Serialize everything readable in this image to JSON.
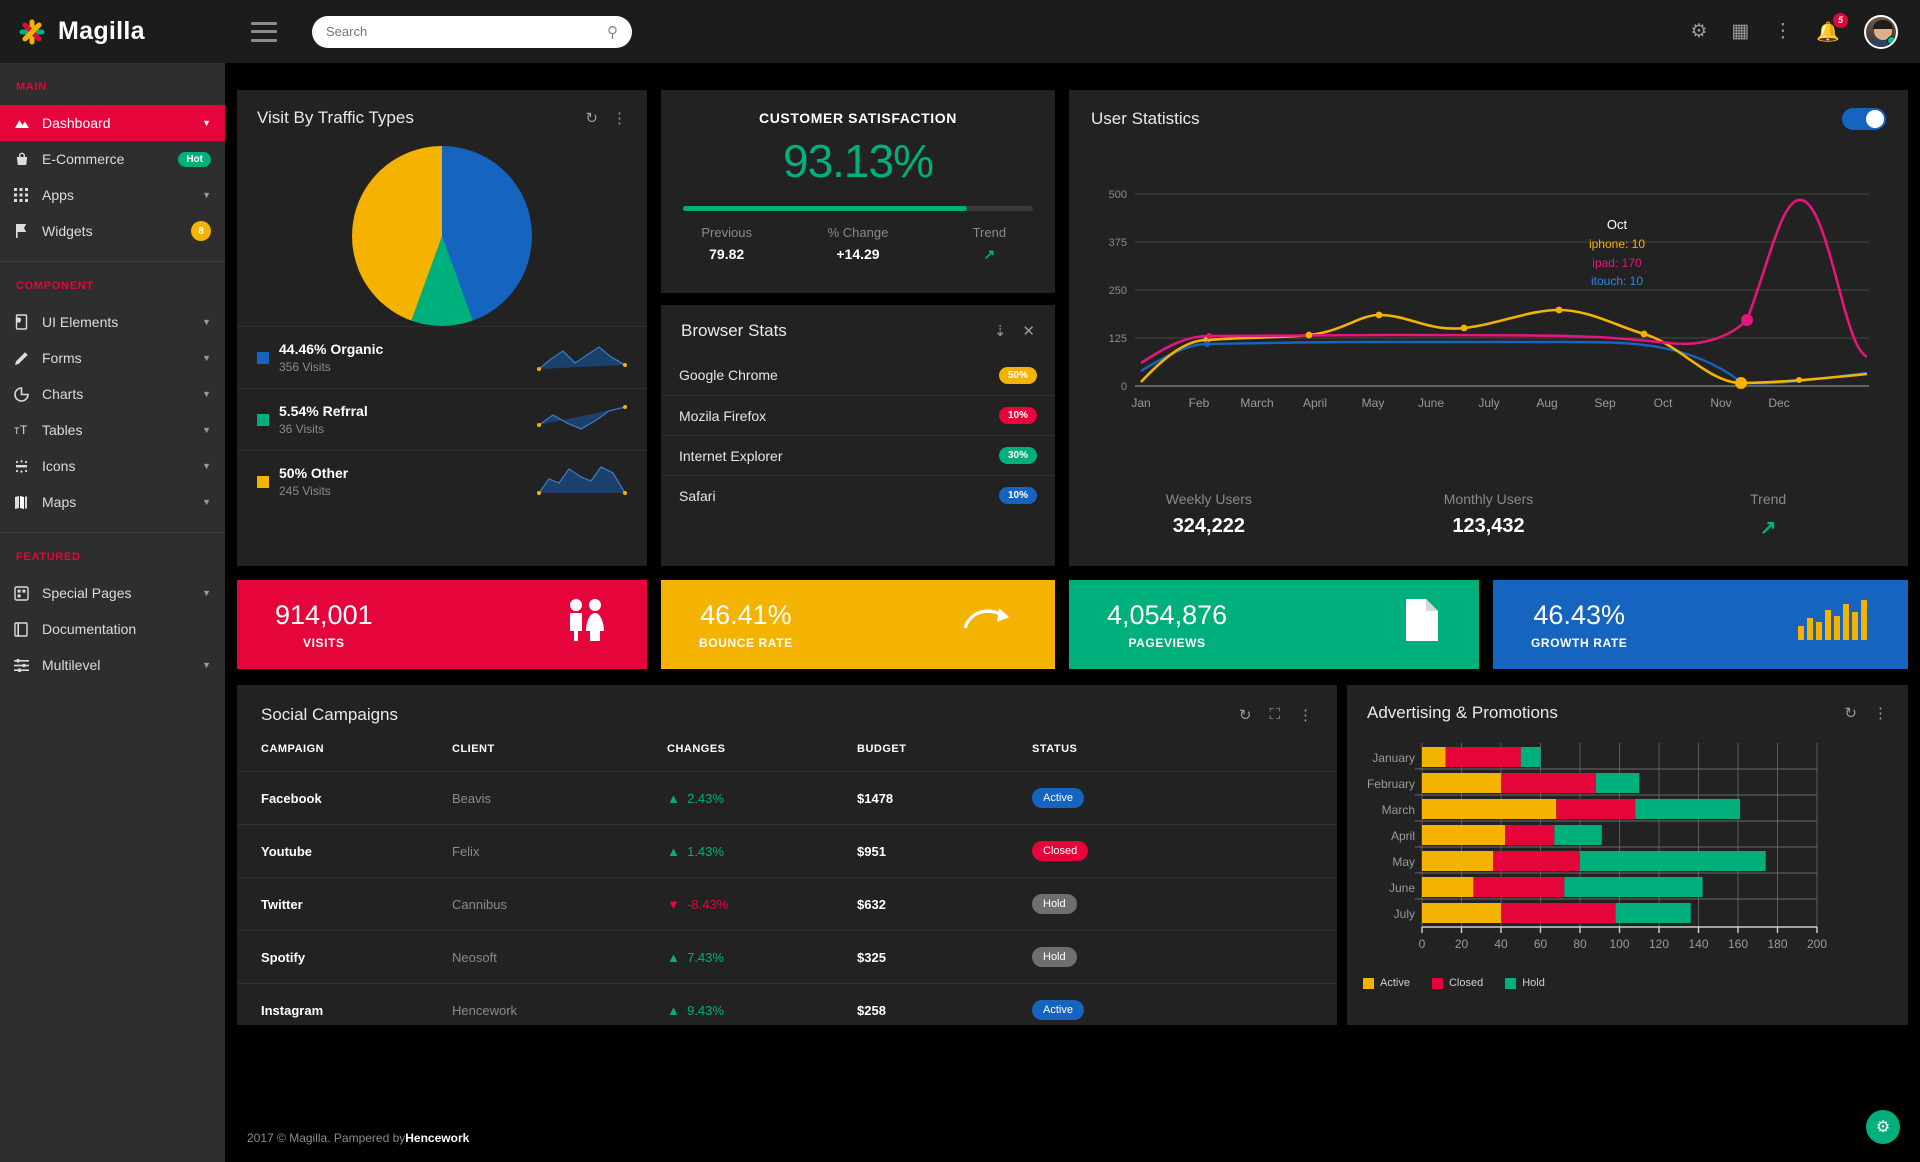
{
  "app": {
    "brand": "Magilla",
    "logo_icon": "asterisk-logo-icon"
  },
  "topbar": {
    "menu_icon": "hamburger-icon",
    "search": {
      "placeholder": "Search",
      "value": "",
      "icon": "search-icon"
    },
    "settings_icon": "gear-icon",
    "apps_icon": "grid-apps-icon",
    "more_icon": "vertical-dots-icon",
    "bell_icon": "bell-icon",
    "notification_count": "5",
    "avatar_icon": "user-avatar"
  },
  "sidebar": {
    "sections": [
      {
        "title": "MAIN",
        "items": [
          {
            "label": "Dashboard",
            "icon": "dashboard-icon",
            "active": true,
            "caret": true,
            "badge": "",
            "badge_type": ""
          },
          {
            "label": "E-Commerce",
            "icon": "basket-icon",
            "active": false,
            "caret": false,
            "badge": "Hot",
            "badge_type": "hot"
          },
          {
            "label": "Apps",
            "icon": "apps-grid-icon",
            "active": false,
            "caret": true,
            "badge": "",
            "badge_type": ""
          },
          {
            "label": "Widgets",
            "icon": "flag-icon",
            "active": false,
            "caret": false,
            "badge": "8",
            "badge_type": "num"
          }
        ]
      },
      {
        "title": "COMPONENT",
        "items": [
          {
            "label": "UI Elements",
            "icon": "ui-elements-icon",
            "active": false,
            "caret": true,
            "badge": "",
            "badge_type": ""
          },
          {
            "label": "Forms",
            "icon": "pencil-icon",
            "active": false,
            "caret": true,
            "badge": "",
            "badge_type": ""
          },
          {
            "label": "Charts",
            "icon": "donut-chart-icon",
            "active": false,
            "caret": true,
            "badge": "",
            "badge_type": ""
          },
          {
            "label": "Tables",
            "icon": "text-size-icon",
            "active": false,
            "caret": true,
            "badge": "",
            "badge_type": ""
          },
          {
            "label": "Icons",
            "icon": "icons-icon",
            "active": false,
            "caret": true,
            "badge": "",
            "badge_type": ""
          },
          {
            "label": "Maps",
            "icon": "map-icon",
            "active": false,
            "caret": true,
            "badge": "",
            "badge_type": ""
          }
        ]
      },
      {
        "title": "FEATURED",
        "items": [
          {
            "label": "Special Pages",
            "icon": "pages-icon",
            "active": false,
            "caret": true,
            "badge": "",
            "badge_type": ""
          },
          {
            "label": "Documentation",
            "icon": "book-icon",
            "active": false,
            "caret": false,
            "badge": "",
            "badge_type": ""
          },
          {
            "label": "Multilevel",
            "icon": "levels-icon",
            "active": false,
            "caret": true,
            "badge": "",
            "badge_type": ""
          }
        ]
      }
    ]
  },
  "traffic": {
    "title": "Visit By Traffic Types",
    "refresh_icon": "refresh-icon",
    "more_icon": "vertical-dots-icon",
    "legend": [
      {
        "label": "44.46% Organic",
        "visits": "356 Visits",
        "color": "#1565c0"
      },
      {
        "label": "5.54% Refrral",
        "visits": "36 Visits",
        "color": "#00b07c"
      },
      {
        "label": "50% Other",
        "visits": "245 Visits",
        "color": "#f5b301"
      }
    ]
  },
  "satisfaction": {
    "title": "CUSTOMER SATISFACTION",
    "value": "93.13%",
    "progress_pct": 81,
    "stats": [
      {
        "label": "Previous",
        "value": "79.82"
      },
      {
        "label": "% Change",
        "value": "+14.29"
      },
      {
        "label": "Trend",
        "value": "↗"
      }
    ]
  },
  "browser": {
    "title": "Browser Stats",
    "download_icon": "download-icon",
    "close_icon": "close-icon",
    "rows": [
      {
        "name": "Google Chrome",
        "pct": "50%",
        "color": "#f5b301"
      },
      {
        "name": "Mozila Firefox",
        "pct": "10%",
        "color": "#e5053a"
      },
      {
        "name": "Internet Explorer",
        "pct": "30%",
        "color": "#00b07c"
      },
      {
        "name": "Safari",
        "pct": "10%",
        "color": "#1565c0"
      }
    ]
  },
  "user_statistics": {
    "title": "User Statistics",
    "toggle_on": true,
    "tooltip": {
      "month": "Oct",
      "iphone": "iphone: 10",
      "ipad": "ipad: 170",
      "itouch": "itouch: 10"
    },
    "footer": [
      {
        "label": "Weekly Users",
        "value": "324,222"
      },
      {
        "label": "Monthly Users",
        "value": "123,432"
      },
      {
        "label": "Trend",
        "value": "↗"
      }
    ],
    "chart_data": {
      "type": "line",
      "title": "User Statistics",
      "x": [
        "Jan",
        "Feb",
        "March",
        "April",
        "May",
        "June",
        "July",
        "Aug",
        "Sep",
        "Oct",
        "Nov",
        "Dec"
      ],
      "ylim": [
        0,
        500
      ],
      "yticks": [
        0,
        125,
        250,
        375,
        500
      ],
      "grid": true,
      "legend": "none",
      "series": [
        {
          "name": "iphone",
          "color": "#f5b301",
          "values": [
            10,
            120,
            125,
            130,
            185,
            150,
            175,
            200,
            150,
            10,
            20,
            30
          ]
        },
        {
          "name": "ipad",
          "color": "#e5157e",
          "values": [
            60,
            130,
            130,
            130,
            135,
            135,
            135,
            130,
            120,
            170,
            470,
            250
          ]
        },
        {
          "name": "itouch",
          "color": "#1565c0",
          "values": [
            40,
            110,
            110,
            110,
            112,
            112,
            112,
            112,
            110,
            10,
            20,
            33
          ]
        }
      ]
    }
  },
  "tiles": [
    {
      "value": "914,001",
      "label": "VISITS",
      "color": "#e5053a",
      "icon": "people-icon"
    },
    {
      "value": "46.41%",
      "label": "BOUNCE RATE",
      "color": "#f5b301",
      "icon": "curved-arrow-icon"
    },
    {
      "value": "4,054,876",
      "label": "PAGEVIEWS",
      "color": "#00b07c",
      "icon": "document-icon"
    },
    {
      "value": "46.43%",
      "label": "GROWTH RATE",
      "color": "#1565c0",
      "icon": "bar-chart-icon"
    }
  ],
  "social": {
    "title": "Social Campaigns",
    "refresh_icon": "refresh-icon",
    "expand_icon": "expand-icon",
    "more_icon": "vertical-dots-icon",
    "columns": [
      "CAMPAIGN",
      "CLIENT",
      "CHANGES",
      "BUDGET",
      "STATUS"
    ],
    "rows": [
      {
        "campaign": "Facebook",
        "client": "Beavis",
        "change": "2.43%",
        "dir": "up",
        "budget": "$1478",
        "status": "Active",
        "status_type": "active"
      },
      {
        "campaign": "Youtube",
        "client": "Felix",
        "change": "1.43%",
        "dir": "up",
        "budget": "$951",
        "status": "Closed",
        "status_type": "closed"
      },
      {
        "campaign": "Twitter",
        "client": "Cannibus",
        "change": "-8.43%",
        "dir": "down",
        "budget": "$632",
        "status": "Hold",
        "status_type": "hold"
      },
      {
        "campaign": "Spotify",
        "client": "Neosoft",
        "change": "7.43%",
        "dir": "up",
        "budget": "$325",
        "status": "Hold",
        "status_type": "hold"
      },
      {
        "campaign": "Instagram",
        "client": "Hencework",
        "change": "9.43%",
        "dir": "up",
        "budget": "$258",
        "status": "Active",
        "status_type": "active"
      }
    ]
  },
  "advertising": {
    "title": "Advertising & Promotions",
    "refresh_icon": "refresh-icon",
    "more_icon": "vertical-dots-icon",
    "chart_data": {
      "type": "bar",
      "orientation": "horizontal",
      "stacked": true,
      "title": "Advertising & Promotions",
      "categories": [
        "January",
        "February",
        "March",
        "April",
        "May",
        "June",
        "July"
      ],
      "xlabel": "",
      "ylabel": "",
      "xlim": [
        0,
        200
      ],
      "xticks": [
        0,
        20,
        40,
        60,
        80,
        100,
        120,
        140,
        160,
        180,
        200
      ],
      "legend": [
        "Active",
        "Closed",
        "Hold"
      ],
      "legend_position": "bottom-left",
      "series": [
        {
          "name": "Active",
          "color": "#f5b301",
          "values": [
            12,
            40,
            68,
            42,
            36,
            26,
            40
          ]
        },
        {
          "name": "Closed",
          "color": "#e5053a",
          "values": [
            38,
            48,
            40,
            25,
            44,
            46,
            58
          ]
        },
        {
          "name": "Hold",
          "color": "#00b07c",
          "values": [
            10,
            22,
            53,
            24,
            94,
            70,
            38
          ]
        }
      ]
    }
  },
  "footer": {
    "text": "2017 © Magilla. Pampered by ",
    "brand": "Hencework",
    "fab_icon": "gear-icon"
  }
}
